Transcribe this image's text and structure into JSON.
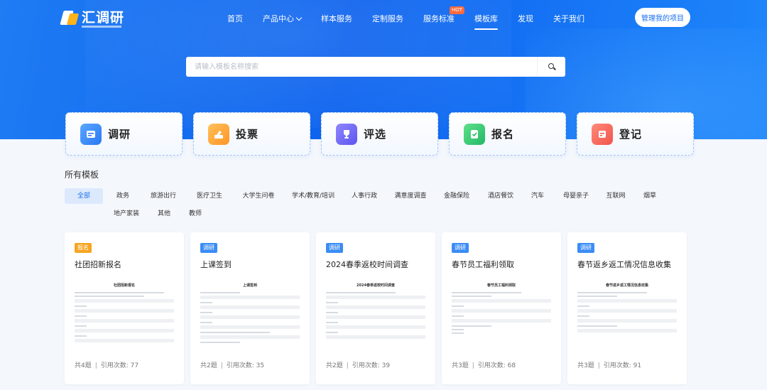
{
  "logo": {
    "text": "汇调研"
  },
  "nav": {
    "items": [
      {
        "label": "首页"
      },
      {
        "label": "产品中心"
      },
      {
        "label": "样本服务"
      },
      {
        "label": "定制服务"
      },
      {
        "label": "服务标准",
        "badge": "HOT"
      },
      {
        "label": "模板库"
      },
      {
        "label": "发现"
      },
      {
        "label": "关于我们"
      }
    ],
    "manage_label": "管理我的项目"
  },
  "search": {
    "placeholder": "请输入模板名称搜索"
  },
  "categories": [
    {
      "label": "调研",
      "icon": "survey-icon"
    },
    {
      "label": "投票",
      "icon": "vote-icon"
    },
    {
      "label": "评选",
      "icon": "trophy-icon"
    },
    {
      "label": "报名",
      "icon": "signup-icon"
    },
    {
      "label": "登记",
      "icon": "register-icon"
    }
  ],
  "templates_section": {
    "title": "所有模板"
  },
  "tags": [
    "全部",
    "政务",
    "旅游出行",
    "医疗卫生",
    "大学生问卷",
    "学术/教育/培训",
    "人事行政",
    "满意度调查",
    "金融保险",
    "酒店餐饮",
    "汽车",
    "母婴亲子",
    "互联网",
    "烟草",
    "地产家装",
    "其他",
    "教师"
  ],
  "cards": [
    {
      "badge": "报名",
      "title": "社团招新报名",
      "preview_title": "社团招新报名",
      "questions": "共4题",
      "usage": "引用次数: 77"
    },
    {
      "badge": "调研",
      "title": "上课签到",
      "preview_title": "上课签到",
      "questions": "共2题",
      "usage": "引用次数: 35"
    },
    {
      "badge": "调研",
      "title": "2024春季返校时间调查",
      "preview_title": "2024春季返校时间调查",
      "questions": "共2题",
      "usage": "引用次数: 39"
    },
    {
      "badge": "调研",
      "title": "春节员工福利领取",
      "preview_title": "春节员工福利领取",
      "questions": "共3题",
      "usage": "引用次数: 68"
    },
    {
      "badge": "调研",
      "title": "春节返乡返工情况信息收集",
      "preview_title": "春节返乡返工情况信息收集",
      "questions": "共3题",
      "usage": "引用次数: 91"
    }
  ],
  "colors": {
    "primary": "#1a6ff0",
    "hero_start": "#1f7cf3",
    "badge_orange": "#f5a623",
    "badge_blue": "#3b8cf5",
    "tag_active_bg": "#dce9fc"
  }
}
